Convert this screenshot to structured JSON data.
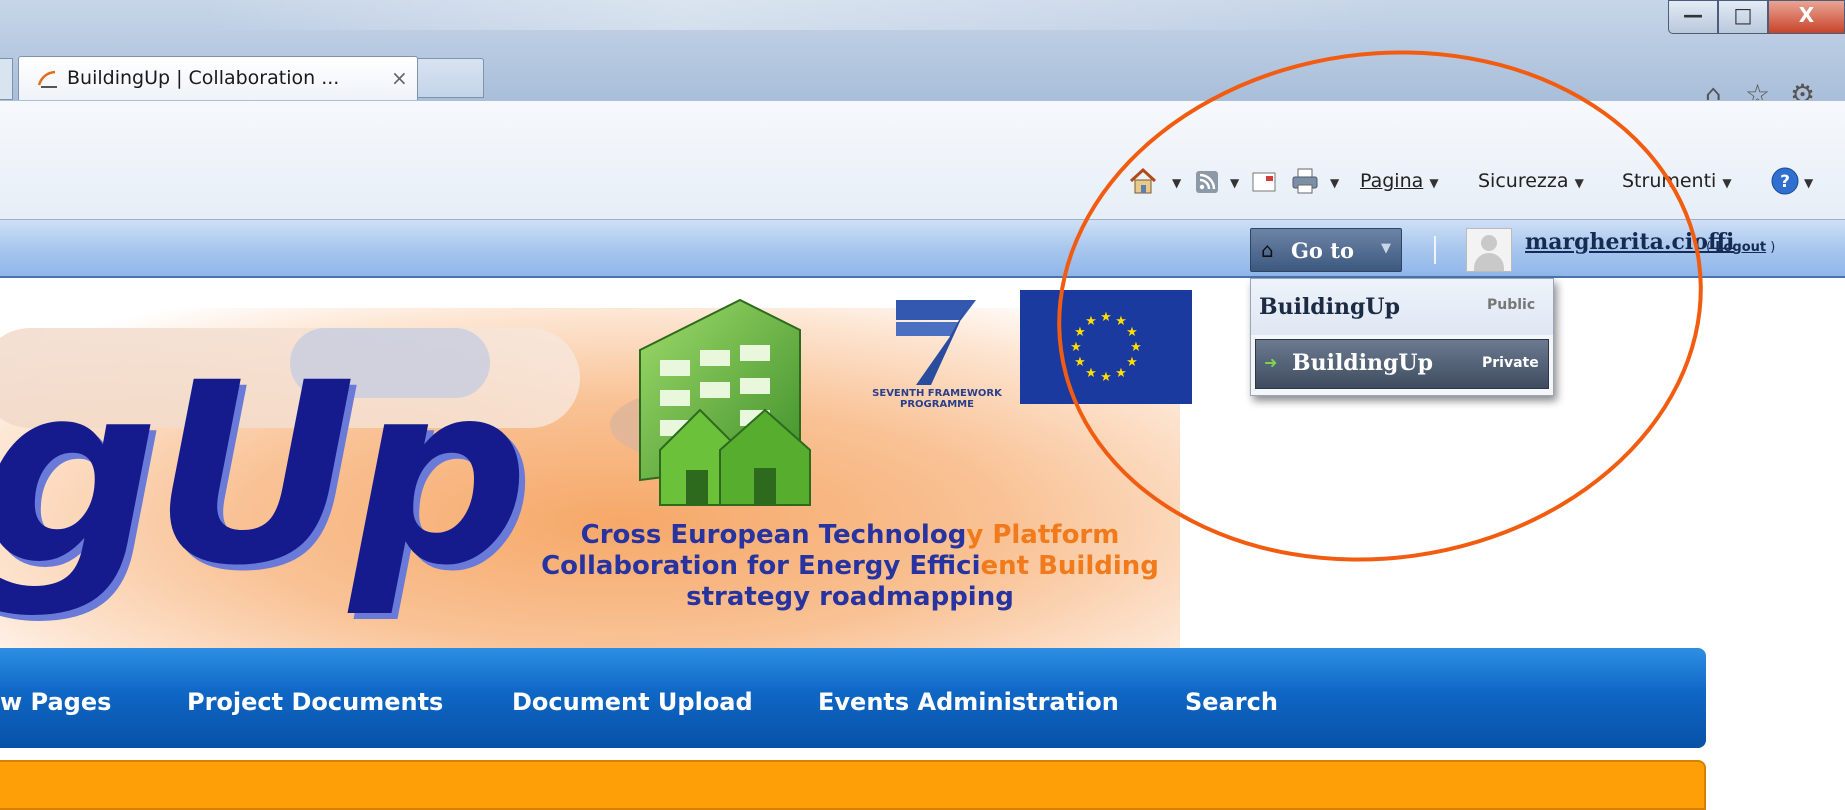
{
  "browser": {
    "tab_title": "BuildingUp | Collaboration ...",
    "tab_close": "×",
    "window_controls": {
      "minimize": "—",
      "maximize": "□",
      "close": "X"
    },
    "icons": [
      "home-icon",
      "star-icon",
      "gear-icon"
    ]
  },
  "command_bar": {
    "pagina": "Pagina",
    "sicurezza": "Sicurezza",
    "strumenti": "Strumenti",
    "icons": [
      "home-icon",
      "rss-icon",
      "mail-icon",
      "print-icon",
      "help-icon"
    ]
  },
  "sharepoint_bar": {
    "goto_label": "Go to",
    "username": "margherita.cioffi",
    "logout_prefix": "( ",
    "logout_label": "Logout",
    "logout_suffix": " )"
  },
  "goto_menu": {
    "items": [
      {
        "label": "BuildingUp",
        "tag": "Public"
      },
      {
        "label": "BuildingUp",
        "tag": "Private"
      }
    ]
  },
  "banner": {
    "logo_text": "gUp",
    "fp7_text": "SEVENTH FRAMEWORK PROGRAMME",
    "tagline": {
      "line1_blue": "Cross European Technolog",
      "line1_orange": "y Platform",
      "line2_blue": "Collaboration for Energy Effici",
      "line2_orange": "ent Building",
      "line3": "strategy roadmapping"
    }
  },
  "nav": {
    "items": [
      "w Pages",
      "Project Documents",
      "Document Upload",
      "Events Administration",
      "Search"
    ]
  },
  "colors": {
    "annotation": "#f25c10",
    "nav_blue": "#0f66c5",
    "orange_bar": "#ff9f08",
    "logo_blue": "#151b8d"
  }
}
